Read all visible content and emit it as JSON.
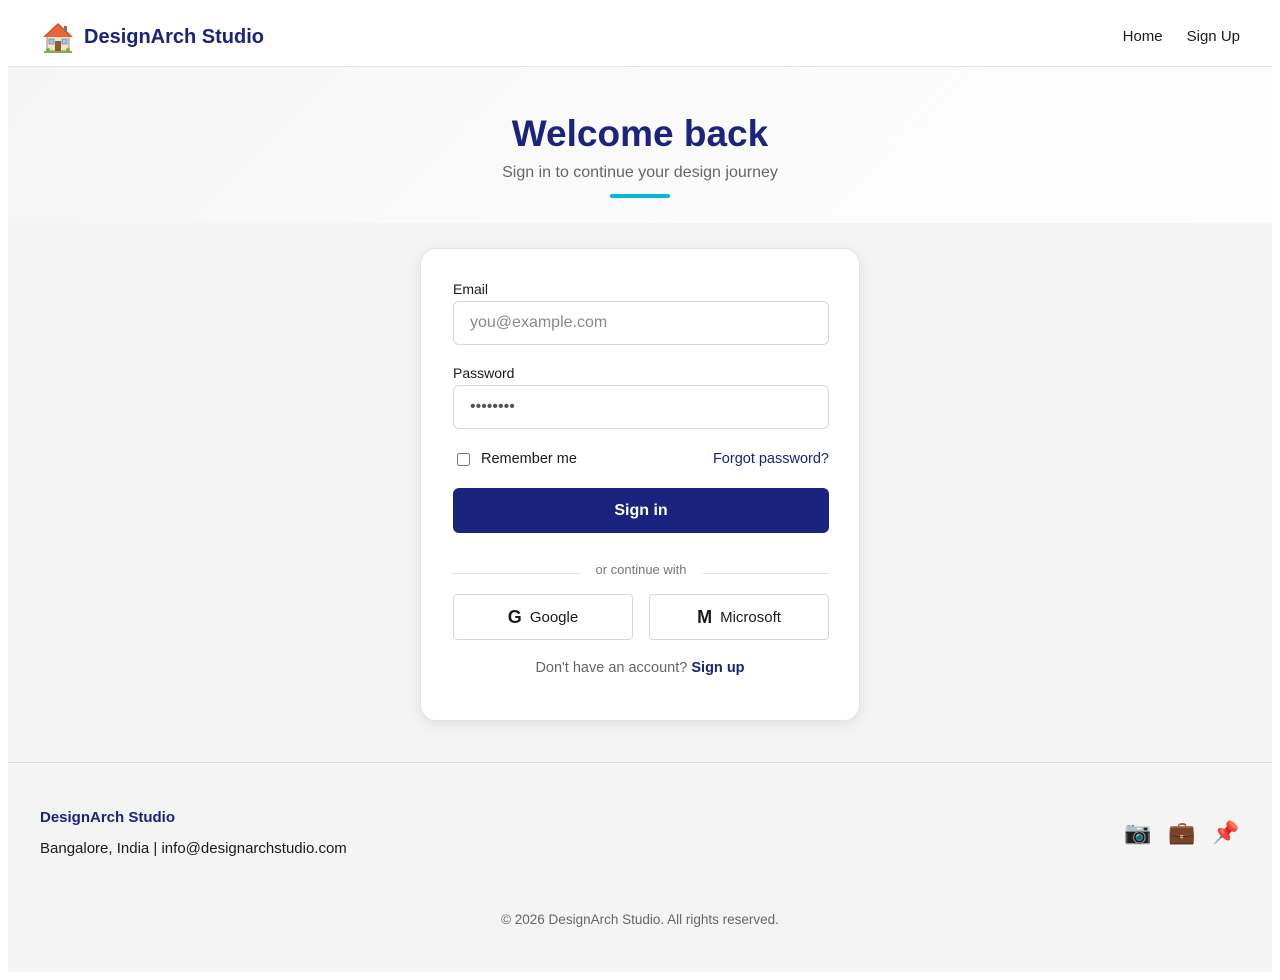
{
  "header": {
    "brand_icon": "house-icon",
    "brand_name": "DesignArch Studio",
    "nav": [
      {
        "label": "Home"
      },
      {
        "label": "Sign Up"
      }
    ]
  },
  "hero": {
    "title": "Welcome back",
    "subtitle": "Sign in to continue your design journey",
    "accent_color": "#00bcd4"
  },
  "form": {
    "email_label": "Email",
    "email_placeholder": "you@example.com",
    "password_label": "Password",
    "password_value": "••••••••",
    "remember_label": "Remember me",
    "forgot_label": "Forgot password?",
    "signin_label": "Sign in",
    "divider_text": "or continue with",
    "google_glyph": "G",
    "google_label": "Google",
    "microsoft_glyph": "M",
    "microsoft_label": "Microsoft",
    "signup_prompt": "Don't have an account?",
    "signup_link": "Sign up"
  },
  "footer": {
    "brand": "DesignArch Studio",
    "info": "Bangalore, India | info@designarchstudio.com",
    "social_icons": [
      {
        "name": "camera-icon",
        "glyph": "📷"
      },
      {
        "name": "briefcase-icon",
        "glyph": "💼"
      },
      {
        "name": "pushpin-icon",
        "glyph": "📌"
      }
    ],
    "copyright": "© 2026 DesignArch Studio. All rights reserved."
  },
  "colors": {
    "brand": "#1a237e",
    "accent": "#00bcd4",
    "background": "#f4f4f4"
  }
}
